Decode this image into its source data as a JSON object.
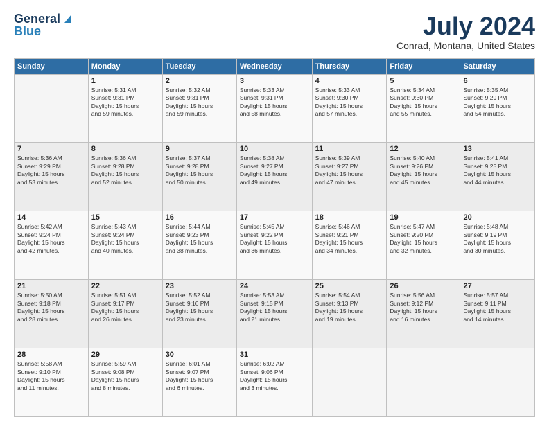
{
  "header": {
    "logo_line1": "General",
    "logo_line2": "Blue",
    "main_title": "July 2024",
    "subtitle": "Conrad, Montana, United States"
  },
  "days_of_week": [
    "Sunday",
    "Monday",
    "Tuesday",
    "Wednesday",
    "Thursday",
    "Friday",
    "Saturday"
  ],
  "weeks": [
    [
      {
        "day": "",
        "info": ""
      },
      {
        "day": "1",
        "info": "Sunrise: 5:31 AM\nSunset: 9:31 PM\nDaylight: 15 hours\nand 59 minutes."
      },
      {
        "day": "2",
        "info": "Sunrise: 5:32 AM\nSunset: 9:31 PM\nDaylight: 15 hours\nand 59 minutes."
      },
      {
        "day": "3",
        "info": "Sunrise: 5:33 AM\nSunset: 9:31 PM\nDaylight: 15 hours\nand 58 minutes."
      },
      {
        "day": "4",
        "info": "Sunrise: 5:33 AM\nSunset: 9:30 PM\nDaylight: 15 hours\nand 57 minutes."
      },
      {
        "day": "5",
        "info": "Sunrise: 5:34 AM\nSunset: 9:30 PM\nDaylight: 15 hours\nand 55 minutes."
      },
      {
        "day": "6",
        "info": "Sunrise: 5:35 AM\nSunset: 9:29 PM\nDaylight: 15 hours\nand 54 minutes."
      }
    ],
    [
      {
        "day": "7",
        "info": "Sunrise: 5:36 AM\nSunset: 9:29 PM\nDaylight: 15 hours\nand 53 minutes."
      },
      {
        "day": "8",
        "info": "Sunrise: 5:36 AM\nSunset: 9:28 PM\nDaylight: 15 hours\nand 52 minutes."
      },
      {
        "day": "9",
        "info": "Sunrise: 5:37 AM\nSunset: 9:28 PM\nDaylight: 15 hours\nand 50 minutes."
      },
      {
        "day": "10",
        "info": "Sunrise: 5:38 AM\nSunset: 9:27 PM\nDaylight: 15 hours\nand 49 minutes."
      },
      {
        "day": "11",
        "info": "Sunrise: 5:39 AM\nSunset: 9:27 PM\nDaylight: 15 hours\nand 47 minutes."
      },
      {
        "day": "12",
        "info": "Sunrise: 5:40 AM\nSunset: 9:26 PM\nDaylight: 15 hours\nand 45 minutes."
      },
      {
        "day": "13",
        "info": "Sunrise: 5:41 AM\nSunset: 9:25 PM\nDaylight: 15 hours\nand 44 minutes."
      }
    ],
    [
      {
        "day": "14",
        "info": "Sunrise: 5:42 AM\nSunset: 9:24 PM\nDaylight: 15 hours\nand 42 minutes."
      },
      {
        "day": "15",
        "info": "Sunrise: 5:43 AM\nSunset: 9:24 PM\nDaylight: 15 hours\nand 40 minutes."
      },
      {
        "day": "16",
        "info": "Sunrise: 5:44 AM\nSunset: 9:23 PM\nDaylight: 15 hours\nand 38 minutes."
      },
      {
        "day": "17",
        "info": "Sunrise: 5:45 AM\nSunset: 9:22 PM\nDaylight: 15 hours\nand 36 minutes."
      },
      {
        "day": "18",
        "info": "Sunrise: 5:46 AM\nSunset: 9:21 PM\nDaylight: 15 hours\nand 34 minutes."
      },
      {
        "day": "19",
        "info": "Sunrise: 5:47 AM\nSunset: 9:20 PM\nDaylight: 15 hours\nand 32 minutes."
      },
      {
        "day": "20",
        "info": "Sunrise: 5:48 AM\nSunset: 9:19 PM\nDaylight: 15 hours\nand 30 minutes."
      }
    ],
    [
      {
        "day": "21",
        "info": "Sunrise: 5:50 AM\nSunset: 9:18 PM\nDaylight: 15 hours\nand 28 minutes."
      },
      {
        "day": "22",
        "info": "Sunrise: 5:51 AM\nSunset: 9:17 PM\nDaylight: 15 hours\nand 26 minutes."
      },
      {
        "day": "23",
        "info": "Sunrise: 5:52 AM\nSunset: 9:16 PM\nDaylight: 15 hours\nand 23 minutes."
      },
      {
        "day": "24",
        "info": "Sunrise: 5:53 AM\nSunset: 9:15 PM\nDaylight: 15 hours\nand 21 minutes."
      },
      {
        "day": "25",
        "info": "Sunrise: 5:54 AM\nSunset: 9:13 PM\nDaylight: 15 hours\nand 19 minutes."
      },
      {
        "day": "26",
        "info": "Sunrise: 5:56 AM\nSunset: 9:12 PM\nDaylight: 15 hours\nand 16 minutes."
      },
      {
        "day": "27",
        "info": "Sunrise: 5:57 AM\nSunset: 9:11 PM\nDaylight: 15 hours\nand 14 minutes."
      }
    ],
    [
      {
        "day": "28",
        "info": "Sunrise: 5:58 AM\nSunset: 9:10 PM\nDaylight: 15 hours\nand 11 minutes."
      },
      {
        "day": "29",
        "info": "Sunrise: 5:59 AM\nSunset: 9:08 PM\nDaylight: 15 hours\nand 8 minutes."
      },
      {
        "day": "30",
        "info": "Sunrise: 6:01 AM\nSunset: 9:07 PM\nDaylight: 15 hours\nand 6 minutes."
      },
      {
        "day": "31",
        "info": "Sunrise: 6:02 AM\nSunset: 9:06 PM\nDaylight: 15 hours\nand 3 minutes."
      },
      {
        "day": "",
        "info": ""
      },
      {
        "day": "",
        "info": ""
      },
      {
        "day": "",
        "info": ""
      }
    ]
  ]
}
